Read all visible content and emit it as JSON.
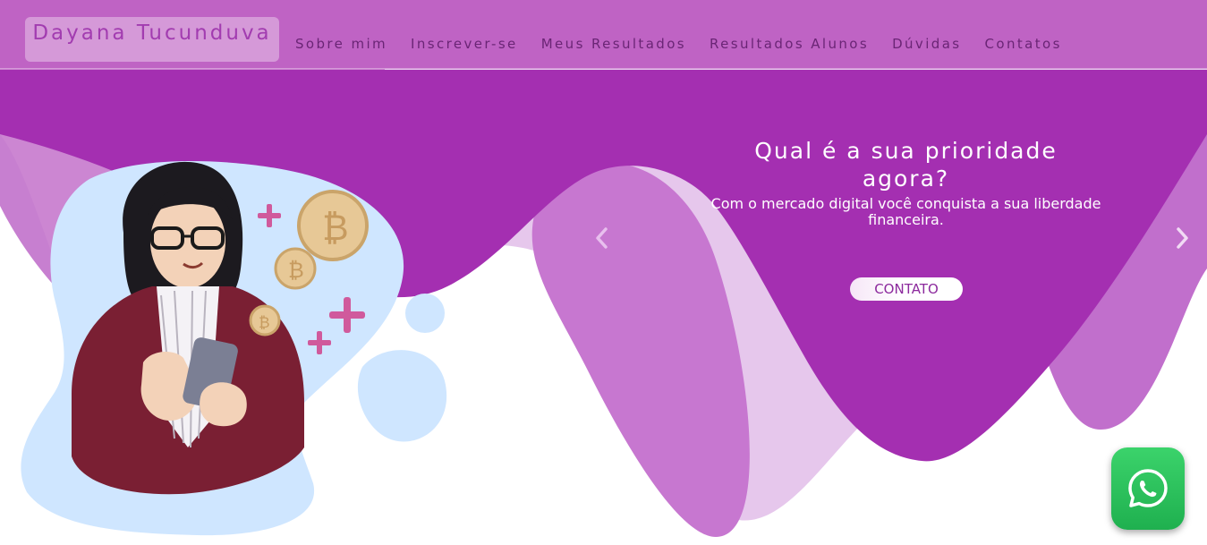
{
  "navbar": {
    "brand": "Dayana Tucunduva",
    "links": [
      "Sobre mim",
      "Inscrever-se",
      "Meus Resultados",
      "Resultados Alunos",
      "Dúvidas",
      "Contatos"
    ]
  },
  "carousel": {
    "title": "Qual é a sua prioridade agora?",
    "subtitle": "Com o mercado digital você conquista a sua liberdade financeira.",
    "cta_label": "CONTATO",
    "prev_icon": "chevron-left-icon",
    "next_icon": "chevron-right-icon"
  },
  "whatsapp": {
    "icon": "whatsapp-icon"
  },
  "colors": {
    "primary": "#a42fb1",
    "nav_bg": "#bf63c4",
    "wave_mid": "#c77fd0",
    "wave_light": "#e6c7ec",
    "blob": "#cfe6ff",
    "whatsapp": "#25d366"
  }
}
